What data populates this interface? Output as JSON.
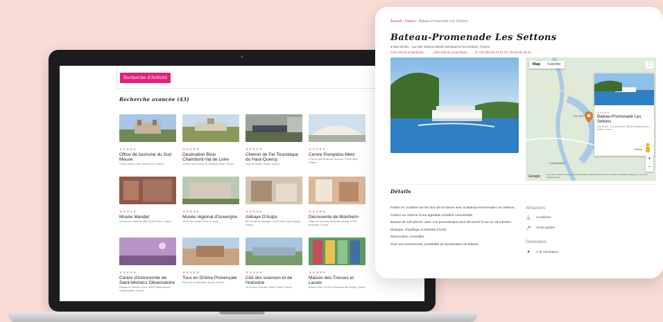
{
  "results": {
    "search_button": "Recherche d'Activité",
    "title": "Recherche avancée (43)",
    "items": [
      {
        "name": "Office de tourisme du Sud Meuse",
        "address": "1 Rue Jeanne d'Arc, Bar-le-Duc, France",
        "stars": "★★★★★"
      },
      {
        "name": "Destination Blois Chambord-Val de Loire",
        "address": "1 Place de la Grève du Château, Blois, France",
        "stars": "★★★★★"
      },
      {
        "name": "Chemin de Fer Touristique du Haut-Quercy",
        "address": "Gare de Martel, Martel, France",
        "stars": "★★★★★"
      },
      {
        "name": "Centre Pompidou-Metz",
        "address": "1 Parvis des Droits de l'Homme, 57020 Metz, France",
        "stars": "★★★★★"
      },
      {
        "name": "Musée Mandet",
        "address": "14 Rue de l'Hôtel de Ville, 63200 Riom, France",
        "stars": "★★★★★"
      },
      {
        "name": "Musée régional d'Auvergne",
        "address": "10 bis Rue Delille, Riom, France",
        "stars": "★★★★★"
      },
      {
        "name": "Abbaye D'Aulps",
        "address": "961 Route de l'Abbaye, 74110 Saint-Jean-d'Aulps, France",
        "stars": "★★★★★"
      },
      {
        "name": "Découverte de Molsheim",
        "address": "Office de Tourisme Molsheim-Mutzig, 67120 Molsheim, France",
        "stars": "★★★★★"
      },
      {
        "name": "Centre d'Astronomie de Saint-Michel-L'Observatoire",
        "address": "Plateau du Moulin à Vent, 04870 Saint-Michel-l'Observatoire, France",
        "stars": "★★★★★"
      },
      {
        "name": "Tous en Drôme Provençale",
        "address": "Place de la Libération, Nyons, France",
        "stars": "★★★★★"
      },
      {
        "name": "Cité des sciences et de l'industrie",
        "address": "30 Avenue Corentin Cariou, Paris, France",
        "stars": "★★★★★"
      },
      {
        "name": "Maison des Tresses et Lacets",
        "address": "Moulin Pinel, 42740 La Terrasse-sur-Dorlay, France",
        "stars": "★★★★★"
      }
    ]
  },
  "detail": {
    "breadcrumb": {
      "home": "Accueil",
      "country": "France",
      "current": "Bateau-Promenade Les Settons"
    },
    "title": "Bateau-Promenade Les Settons",
    "address": "Mon Dinélo - Lac des Settons 58230 Montsauche-les-Settons, France",
    "email": "E-mail du propriétaire",
    "website": "Site web du propriétaire",
    "phone": "+33 (0)6 84 72 51 07 / 06 83 00 36 16",
    "map": {
      "tab_map": "Map",
      "tab_satellite": "Satellite",
      "popup_stars": "★★★★★",
      "popup_name": "Bateau-Promenade Les Settons",
      "popup_address": "Mon Dinélo - Lac des Settons 58230 Montsauche-les-Settons, France",
      "popup_button": "Fermer",
      "footer": "Raccourcis clavier   Données cartographiques ©2023 Google   500 m   Conditions d'utilisation   Signaler une erreur cartographique",
      "google": "Google",
      "label_settons": "LES SETTONS",
      "label_chaumard": "CHAUMARD"
    },
    "details_title": "Détails",
    "description": [
      "Partez en croisière sur les lacs de la Nièvre avec le Bateau-Promenade Les Settons.",
      "Goûtez au charme d'une agréable croisière commentée.",
      "Bateau de 100 places, avec vue panoramique pour découvrir le lac en 45 minutes.",
      "Musique, chauffage et toilettes à bord.",
      "Réservation conseillée.",
      "Pour vos événements, possibilité de privatisation du bateau."
    ],
    "attractions_title": "Attractions",
    "attractions": [
      "Croisières",
      "Visite guidée"
    ],
    "destination_title": "Destination",
    "destination": "À la campagne"
  }
}
